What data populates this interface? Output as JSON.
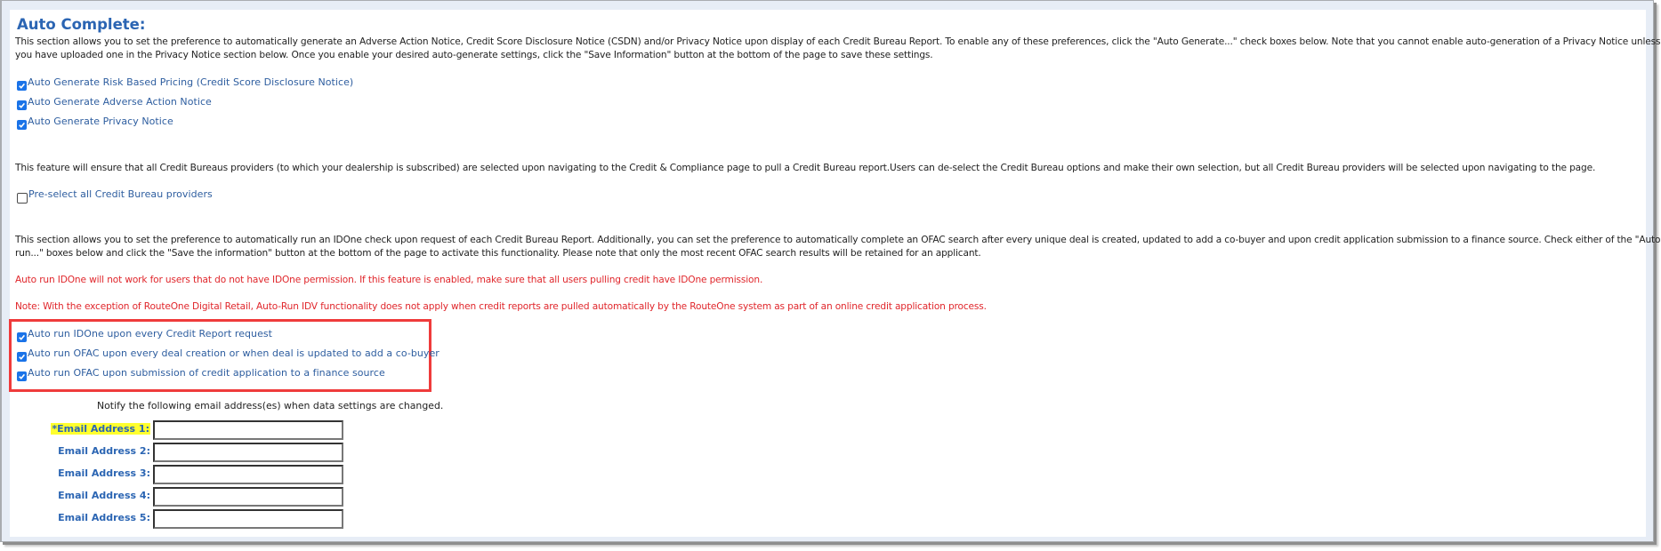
{
  "section": {
    "title": "Auto Complete:",
    "intro_line1": "This section allows you to set the preference to automatically generate an Adverse Action Notice, Credit Score Disclosure Notice (CSDN) and/or Privacy Notice upon display of each Credit Bureau Report. To enable any of these preferences, click the \"Auto Generate...\" check boxes below. Note that you cannot enable auto-generation of a Privacy Notice unless",
    "intro_line2": "you have uploaded one in the Privacy Notice section below. Once you enable your desired auto-generate settings, click the \"Save Information\" button at the bottom of the page to save these settings."
  },
  "auto_generate": [
    {
      "label": "Auto Generate Risk Based Pricing (Credit Score Disclosure Notice)",
      "checked": true
    },
    {
      "label": "Auto Generate Adverse Action Notice",
      "checked": true
    },
    {
      "label": "Auto Generate Privacy Notice",
      "checked": true
    }
  ],
  "bureau": {
    "description": "This feature will ensure that all Credit Bureaus providers (to which your dealership is subscribed) are selected upon navigating to the Credit & Compliance page to pull a Credit Bureau report.Users can de-select the Credit Bureau options and make their own selection, but all Credit Bureau providers will be selected upon navigating to the page.",
    "preselect": {
      "label": "Pre-select all Credit Bureau providers",
      "checked": false
    }
  },
  "idone": {
    "description_line1": "This section allows you to set the preference to automatically run an IDOne check upon request of each Credit Bureau Report. Additionally, you can set the preference to automatically complete an OFAC search after every unique deal is created, updated to add a co-buyer and upon credit application submission to a finance source. Check either of the \"Auto",
    "description_line2": "run...\" boxes below and click the \"Save the information\" button at the bottom of the page to activate this functionality. Please note that only the most recent OFAC search results will be retained for an applicant.",
    "warning": "Auto run IDOne will not work for users that do not have IDOne permission. If this feature is enabled, make sure that all users pulling credit have IDOne permission.",
    "note": "Note: With the exception of RouteOne Digital Retail, Auto-Run IDV functionality does not apply when credit reports are pulled automatically by the RouteOne system as part of an online credit application process.",
    "options": [
      {
        "label": "Auto run IDOne upon every Credit Report request",
        "checked": true
      },
      {
        "label": "Auto run OFAC upon every deal creation or when deal is updated to add a co-buyer",
        "checked": true
      },
      {
        "label": "Auto run OFAC upon submission of credit application to a finance source",
        "checked": true
      }
    ]
  },
  "notify": {
    "text": "Notify the following email address(es) when data settings are changed.",
    "emails": [
      {
        "label": "*Email Address 1:",
        "value": "",
        "required": true
      },
      {
        "label": "Email Address 2:",
        "value": "",
        "required": false
      },
      {
        "label": "Email Address 3:",
        "value": "",
        "required": false
      },
      {
        "label": "Email Address 4:",
        "value": "",
        "required": false
      },
      {
        "label": "Email Address 5:",
        "value": "",
        "required": false
      }
    ]
  },
  "colors": {
    "accent": "#2b65b3",
    "checkbox": "#1a73e8",
    "warning_text": "#e0262b",
    "highlight_box": "#ef3b3b",
    "required_highlight": "#ffff2e"
  }
}
